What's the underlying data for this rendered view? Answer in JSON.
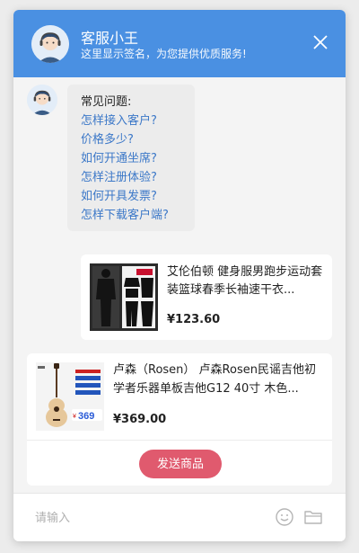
{
  "header": {
    "agent_name": "客服小王",
    "signature": "这里显示签名，为您提供优质服务!"
  },
  "faq": {
    "title": "常见问题:",
    "items": [
      "怎样接入客户?",
      "价格多少?",
      "如何开通坐席?",
      "怎样注册体验?",
      "如何开具发票?",
      "怎样下载客户端?"
    ]
  },
  "product_message": {
    "title": "艾伦伯顿 健身服男跑步运动套装篮球春季长袖速干衣...",
    "price": "¥123.60"
  },
  "product_card": {
    "title": "卢森（Rosen） 卢森Rosen民谣吉他初学者乐器单板吉他G12 40寸 木色...",
    "price": "¥369.00",
    "promo_price": "369",
    "send_label": "发送商品"
  },
  "input": {
    "placeholder": "请输入"
  },
  "colors": {
    "header_bg": "#4a90e2",
    "link": "#3c78c8",
    "send_button": "#e05a6e"
  },
  "icons": [
    "close-icon",
    "smiley-icon",
    "folder-icon"
  ]
}
